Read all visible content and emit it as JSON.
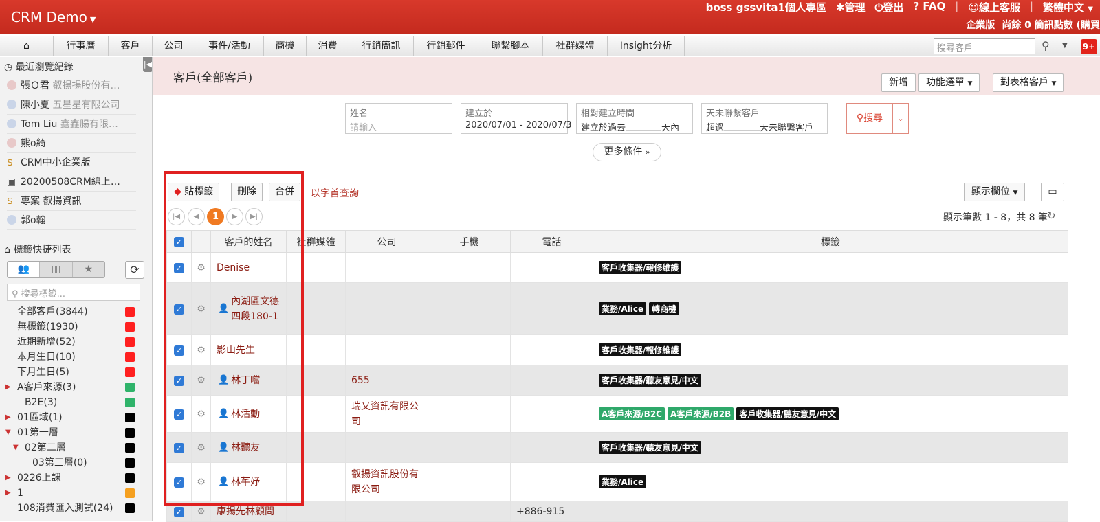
{
  "app": {
    "brand": "CRM Demo",
    "user": "boss gssvita1個人專區",
    "manage": "管理",
    "logout": "登出",
    "faq": "FAQ",
    "online_service": "線上客服",
    "language": "繁體中文",
    "edition": "企業版",
    "sms_credit": "尚餘 0 簡訊點數 (購買"
  },
  "nav": {
    "items": [
      "行事曆",
      "客戶",
      "公司",
      "事件/活動",
      "商機",
      "消費",
      "行銷簡訊",
      "行銷郵件",
      "聯繫腳本",
      "社群媒體",
      "Insight分析"
    ],
    "search_placeholder": "搜尋客戶",
    "notifications": "9+"
  },
  "sidebar": {
    "recent_title": "最近瀏覽紀錄",
    "recent": [
      {
        "name": "張Ｏ君",
        "sub": "叡揚揚股份有…",
        "icon": "female-avatar-icon"
      },
      {
        "name": "陳小夏",
        "sub": "五星星有限公司",
        "icon": "male-avatar-icon"
      },
      {
        "name": "Tom Liu",
        "sub": "鑫鑫腸有限…",
        "icon": "male-avatar-icon"
      },
      {
        "name": "熊o綺",
        "sub": "",
        "icon": "female-avatar-icon"
      },
      {
        "name": "CRM中小企業版",
        "sub": "",
        "icon": "money-bag-icon"
      },
      {
        "name": "20200508CRM線上…",
        "sub": "",
        "icon": "briefcase-icon"
      },
      {
        "name": "專案 叡揚資訊",
        "sub": "",
        "icon": "money-bag-icon"
      },
      {
        "name": "郭o翰",
        "sub": "",
        "icon": "male-avatar-icon"
      }
    ],
    "tags_title": "標籤快捷列表",
    "tag_search_placeholder": "搜尋標籤...",
    "tags": [
      {
        "label": "全部客戶(3844)",
        "color": "#ff2020",
        "indent": 0,
        "arrow": ""
      },
      {
        "label": "無標籤(1930)",
        "color": "#ff2020",
        "indent": 0,
        "arrow": ""
      },
      {
        "label": "近期新增(52)",
        "color": "#ff2020",
        "indent": 0,
        "arrow": ""
      },
      {
        "label": "本月生日(10)",
        "color": "#ff2020",
        "indent": 0,
        "arrow": ""
      },
      {
        "label": "下月生日(5)",
        "color": "#ff2020",
        "indent": 0,
        "arrow": ""
      },
      {
        "label": "A客戶來源(3)",
        "color": "#2fb36a",
        "indent": 0,
        "arrow": "right"
      },
      {
        "label": "B2E(3)",
        "color": "#2fb36a",
        "indent": 1,
        "arrow": ""
      },
      {
        "label": "01區域(1)",
        "color": "#000000",
        "indent": 0,
        "arrow": "right"
      },
      {
        "label": "01第一層",
        "color": "#000000",
        "indent": 0,
        "arrow": "down"
      },
      {
        "label": "02第二層",
        "color": "#000000",
        "indent": 1,
        "arrow": "down"
      },
      {
        "label": "03第三層(0)",
        "color": "#000000",
        "indent": 2,
        "arrow": ""
      },
      {
        "label": "0226上課",
        "color": "#000000",
        "indent": 0,
        "arrow": "right"
      },
      {
        "label": "1",
        "color": "#f5a020",
        "indent": 0,
        "arrow": "right"
      },
      {
        "label": "108消費匯入測試(24)",
        "color": "#000000",
        "indent": 0,
        "arrow": ""
      }
    ]
  },
  "main": {
    "title": "客戶(全部客戶)",
    "btn_new": "新增",
    "btn_menu": "功能選單",
    "btn_table": "對表格客戶",
    "filters": {
      "name_label": "姓名",
      "name_placeholder": "請輸入",
      "created_label": "建立於",
      "created_value": "2020/07/01 - 2020/07/3",
      "relative_label": "相對建立時間",
      "relative_prefix": "建立於過去",
      "relative_suffix": "天內",
      "nocontact_label": "天未聯繫客戶",
      "nocontact_prefix": "超過",
      "nocontact_suffix": "天未聯繫客戶"
    },
    "search_btn": "搜尋",
    "more_conditions": "更多條件",
    "toolbar": {
      "tag": "貼標籤",
      "delete": "刪除",
      "merge": "合併",
      "alpha": "以字首查詢",
      "show_cols": "顯示欄位"
    },
    "current_page": "1",
    "record_info": "顯示筆數 1 - 8，共 8 筆",
    "columns": [
      "客戶的姓名",
      "社群媒體",
      "公司",
      "手機",
      "電話",
      "標籤"
    ],
    "rows": [
      {
        "name": "Denise",
        "person_icon": false,
        "company": "",
        "tags": [
          {
            "t": "客戶收集器/報修維護",
            "c": "black"
          }
        ]
      },
      {
        "name": "內湖區文德四段180-1",
        "person_icon": true,
        "company": "",
        "tags": [
          {
            "t": "業務/Alice",
            "c": "black"
          },
          {
            "t": "轉商機",
            "c": "black"
          }
        ]
      },
      {
        "name": "影山先生",
        "person_icon": false,
        "company": "",
        "tags": [
          {
            "t": "客戶收集器/報修維護",
            "c": "black"
          }
        ]
      },
      {
        "name": "林丁噹",
        "person_icon": true,
        "company": "655",
        "tags": [
          {
            "t": "客戶收集器/聽友意見/中文",
            "c": "black"
          }
        ]
      },
      {
        "name": "林活動",
        "person_icon": true,
        "company": "瑞又資訊有限公司",
        "tags": [
          {
            "t": "A客戶來源/B2C",
            "c": "green"
          },
          {
            "t": "A客戶來源/B2B",
            "c": "green"
          },
          {
            "t": "客戶收集器/聽友意見/中文",
            "c": "black"
          }
        ]
      },
      {
        "name": "林聽友",
        "person_icon": true,
        "company": "",
        "tags": [
          {
            "t": "客戶收集器/聽友意見/中文",
            "c": "black"
          }
        ]
      },
      {
        "name": "林芊妤",
        "person_icon": true,
        "company": "叡揚資訊股份有限公司",
        "tags": [
          {
            "t": "業務/Alice",
            "c": "black"
          }
        ]
      },
      {
        "name": "康揚先林顧問",
        "person_icon": false,
        "company": "",
        "phone": "+886-915",
        "tags": []
      }
    ]
  }
}
